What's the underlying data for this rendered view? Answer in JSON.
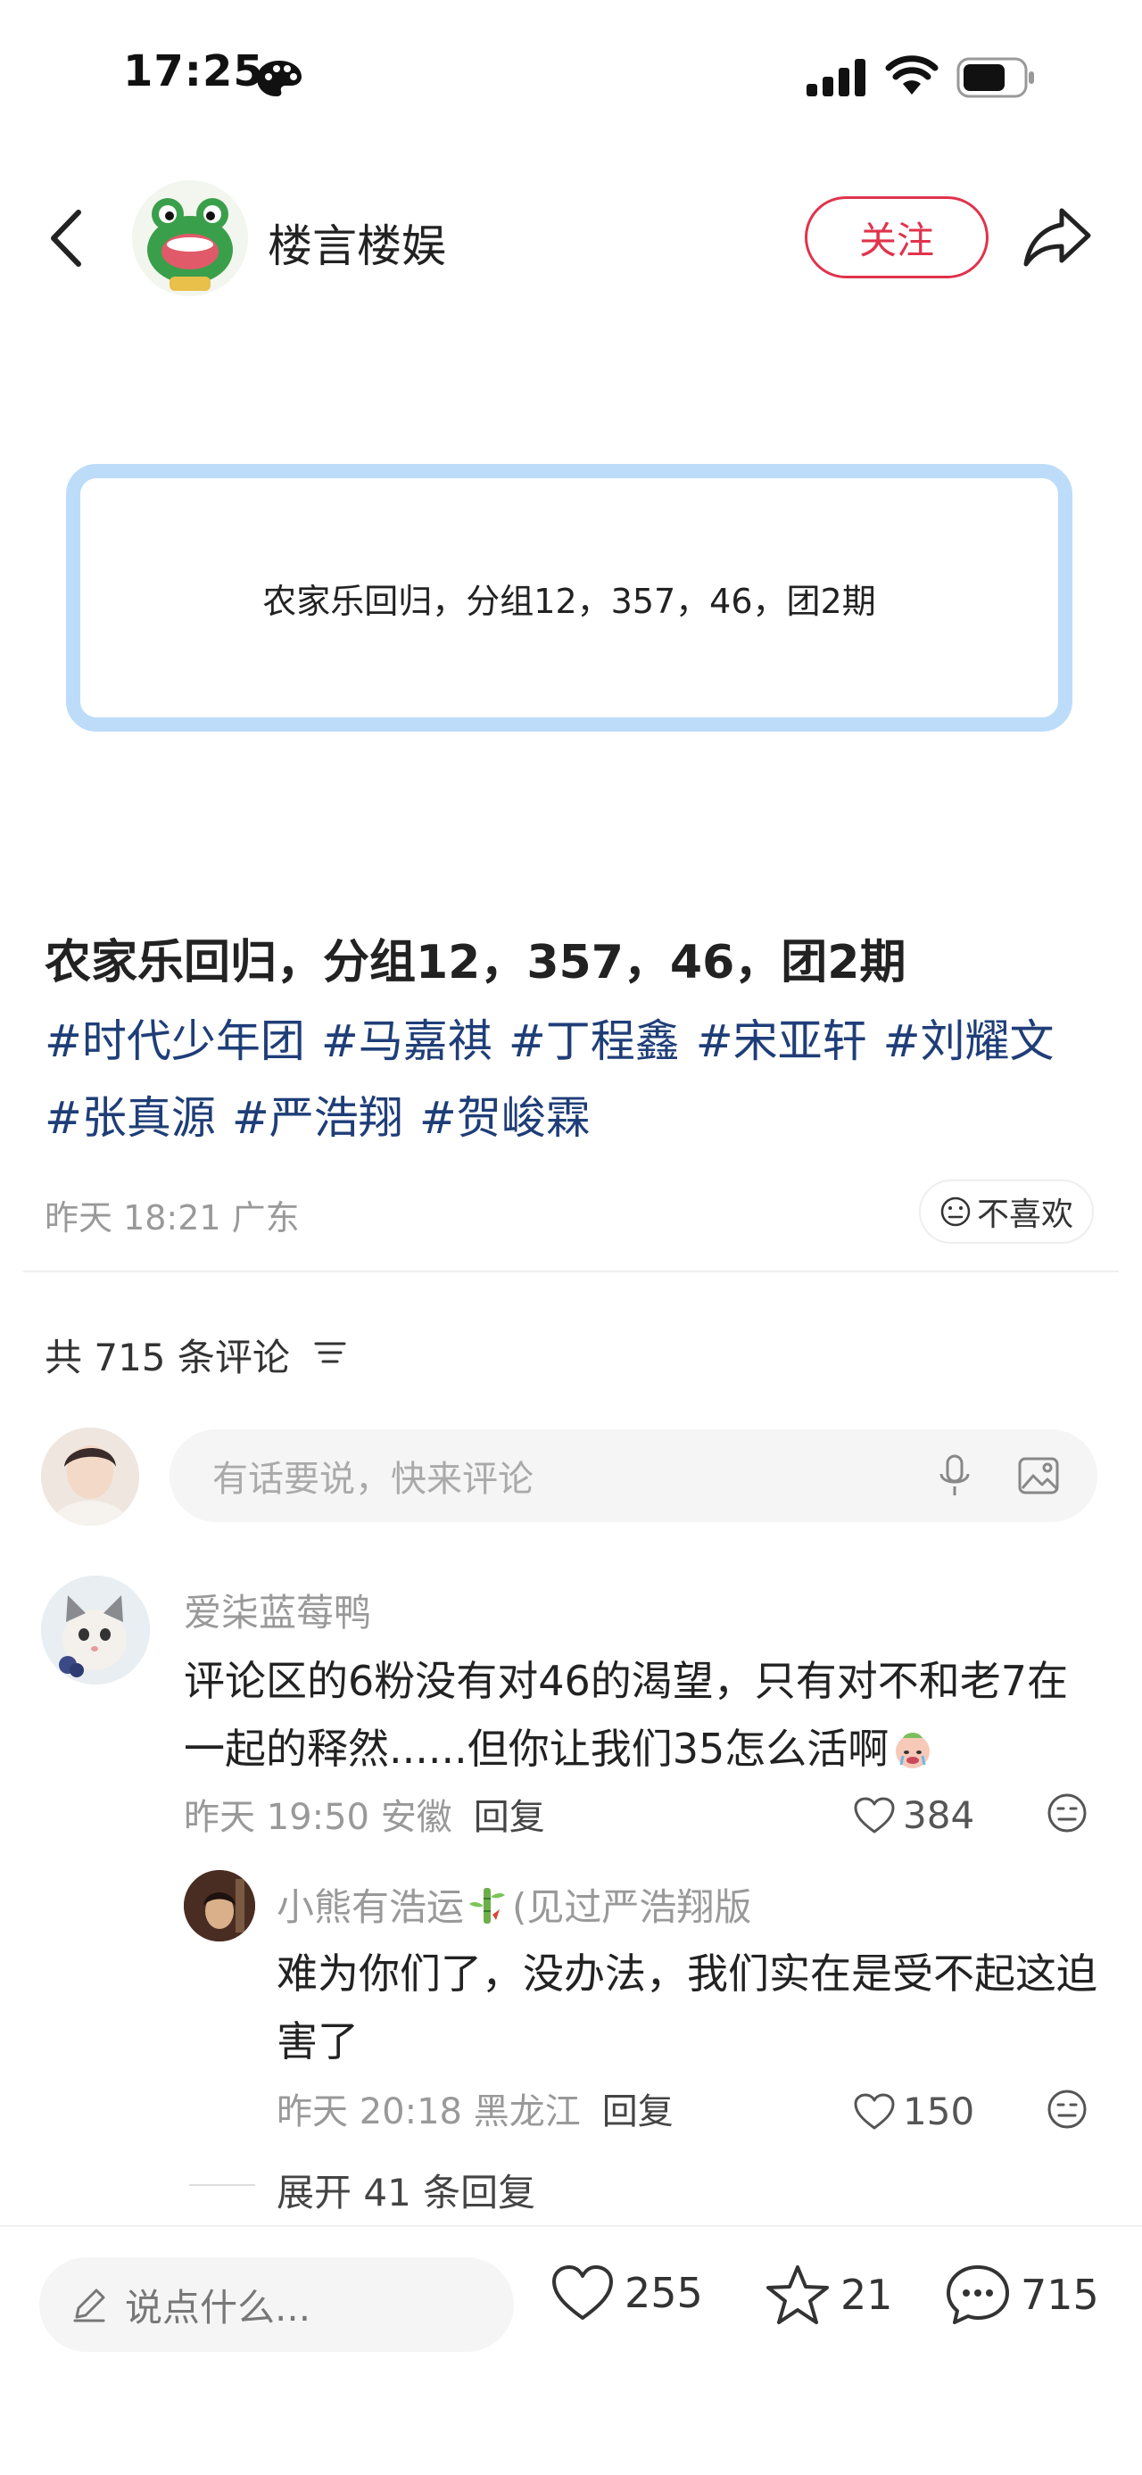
{
  "status_bar": {
    "time": "17:25"
  },
  "header": {
    "author_name": "楼言楼娱",
    "follow_label": "关注"
  },
  "note_card": {
    "text": "农家乐回归，分组12，357，46，团2期"
  },
  "post": {
    "title": "农家乐回归，分组12，357，46，团2期",
    "tags": [
      "#时代少年团",
      "#马嘉祺",
      "#丁程鑫",
      "#宋亚轩",
      "#刘耀文",
      "#张真源",
      "#严浩翔",
      "#贺峻霖"
    ],
    "meta": "昨天 18:21 广东",
    "dislike_label": "不喜欢"
  },
  "comments_section": {
    "count_label": "共 715 条评论",
    "input_placeholder": "有话要说，快来评论"
  },
  "comments": [
    {
      "user": "爱柒蓝莓鸭",
      "text": "评论区的6粉没有对46的渴望，只有对不和老7在一起的释然......但你让我们35怎么活啊",
      "time_location": "昨天 19:50 安徽",
      "reply_label": "回复",
      "likes": "384"
    }
  ],
  "replies": [
    {
      "user": "小熊有浩运",
      "user_suffix": "(见过严浩翔版",
      "text": "难为你们了，没办法，我们实在是受不起这迫害了",
      "time_location": "昨天 20:18 黑龙江",
      "reply_label": "回复",
      "likes": "150"
    }
  ],
  "expand_label": "展开 41 条回复",
  "bottom_bar": {
    "input_placeholder": "说点什么...",
    "likes": "255",
    "collects": "21",
    "comments": "715"
  },
  "colors": {
    "accent_red": "#e0334c",
    "tag_blue": "#1f3e78",
    "card_border": "#bcdcf9"
  }
}
